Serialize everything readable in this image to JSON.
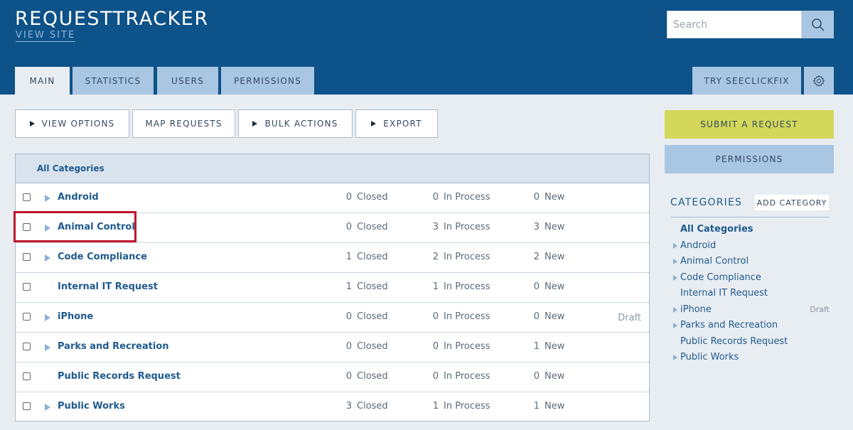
{
  "header": {
    "title": "REQUESTTRACKER",
    "view_site": "VIEW SITE",
    "search_placeholder": "Search"
  },
  "tabs": [
    {
      "label": "MAIN",
      "active": true
    },
    {
      "label": "STATISTICS"
    },
    {
      "label": "USERS"
    },
    {
      "label": "PERMISSIONS"
    }
  ],
  "right_tabs": {
    "try_label": "TRY SEECLICKFIX",
    "gear_icon": "gear-icon"
  },
  "toolbar": {
    "view_options": "VIEW OPTIONS",
    "map_requests": "MAP REQUESTS",
    "bulk_actions": "BULK ACTIONS",
    "export": "EXPORT"
  },
  "table": {
    "header": "All Categories",
    "labels": {
      "closed": "Closed",
      "in_process": "In Process",
      "new": "New"
    },
    "rows": [
      {
        "name": "Android",
        "expandable": true,
        "closed": "0",
        "in_process": "0",
        "new": "0",
        "draft": ""
      },
      {
        "name": "Animal Control",
        "expandable": true,
        "closed": "0",
        "in_process": "3",
        "new": "3",
        "draft": ""
      },
      {
        "name": "Code Compliance",
        "expandable": true,
        "closed": "1",
        "in_process": "2",
        "new": "2",
        "draft": ""
      },
      {
        "name": "Internal IT Request",
        "expandable": false,
        "closed": "1",
        "in_process": "1",
        "new": "0",
        "draft": ""
      },
      {
        "name": "iPhone",
        "expandable": true,
        "closed": "0",
        "in_process": "0",
        "new": "0",
        "draft": "Draft"
      },
      {
        "name": "Parks and Recreation",
        "expandable": true,
        "closed": "0",
        "in_process": "0",
        "new": "1",
        "draft": ""
      },
      {
        "name": "Public Records Request",
        "expandable": false,
        "closed": "0",
        "in_process": "0",
        "new": "0",
        "draft": ""
      },
      {
        "name": "Public Works",
        "expandable": true,
        "closed": "3",
        "in_process": "1",
        "new": "1",
        "draft": ""
      }
    ]
  },
  "sidebar": {
    "submit_label": "SUBMIT A REQUEST",
    "permissions_label": "PERMISSIONS",
    "categories_heading": "CATEGORIES",
    "add_category": "ADD CATEGORY",
    "items": [
      {
        "label": "All Categories",
        "bold": true,
        "expandable": false,
        "draft": ""
      },
      {
        "label": "Android",
        "expandable": true,
        "draft": ""
      },
      {
        "label": "Animal Control",
        "expandable": true,
        "draft": ""
      },
      {
        "label": "Code Compliance",
        "expandable": true,
        "draft": ""
      },
      {
        "label": "Internal IT Request",
        "expandable": false,
        "draft": ""
      },
      {
        "label": "iPhone",
        "expandable": true,
        "draft": "Draft"
      },
      {
        "label": "Parks and Recreation",
        "expandable": true,
        "draft": ""
      },
      {
        "label": "Public Records Request",
        "expandable": false,
        "draft": ""
      },
      {
        "label": "Public Works",
        "expandable": true,
        "draft": ""
      }
    ]
  },
  "colors": {
    "header_bg": "#0d5288",
    "tab_bg": "#a9c6e3",
    "submit_bg": "#d3d85a",
    "link": "#1f5a8e",
    "highlight": "#c0142c"
  }
}
